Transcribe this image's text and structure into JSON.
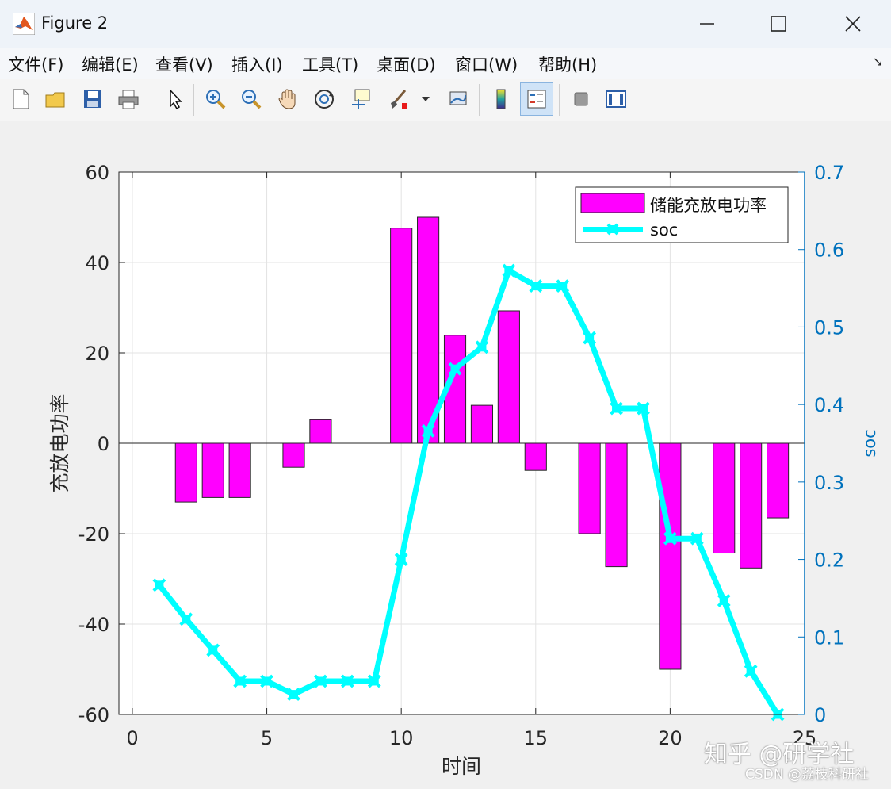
{
  "window": {
    "title": "Figure 2"
  },
  "menu": [
    {
      "label": "文件(F)"
    },
    {
      "label": "编辑(E)"
    },
    {
      "label": "查看(V)"
    },
    {
      "label": "插入(I)"
    },
    {
      "label": "工具(T)"
    },
    {
      "label": "桌面(D)"
    },
    {
      "label": "窗口(W)"
    },
    {
      "label": "帮助(H)"
    }
  ],
  "toolbar": [
    {
      "name": "new-figure-icon"
    },
    {
      "name": "open-file-icon"
    },
    {
      "name": "save-icon"
    },
    {
      "name": "print-icon"
    },
    {
      "name": "pointer-icon"
    },
    {
      "name": "zoom-in-icon"
    },
    {
      "name": "zoom-out-icon"
    },
    {
      "name": "pan-hand-icon"
    },
    {
      "name": "rotate-3d-icon"
    },
    {
      "name": "data-cursor-icon"
    },
    {
      "name": "brush-icon"
    },
    {
      "name": "link-plot-icon"
    },
    {
      "name": "colorbar-icon"
    },
    {
      "name": "legend-icon"
    },
    {
      "name": "hide-plot-tools-icon"
    },
    {
      "name": "show-plot-tools-icon"
    }
  ],
  "colors": {
    "bar": "#ff00ff",
    "line": "#00ffff",
    "right_axis": "#0072bd",
    "text": "#262626"
  },
  "chart_data": {
    "type": "bar+line",
    "xlabel": "时间",
    "ylabel_left": "充放电功率",
    "ylabel_right": "soc",
    "xlim": [
      -0.5,
      25
    ],
    "ylim_left": [
      -60,
      60
    ],
    "ylim_right": [
      0,
      0.7
    ],
    "xticks": [
      0,
      5,
      10,
      15,
      20,
      25
    ],
    "yticks_left": [
      -60,
      -40,
      -20,
      0,
      20,
      40,
      60
    ],
    "yticks_right": [
      0,
      0.1,
      0.2,
      0.3,
      0.4,
      0.5,
      0.6,
      0.7
    ],
    "yticklabels_right": [
      "0",
      "0.1",
      "0.2",
      "0.3",
      "0.4",
      "0.5",
      "0.6",
      "0.7"
    ],
    "grid": true,
    "legend_position": "top-right",
    "series": [
      {
        "name": "储能充放电功率",
        "type": "bar",
        "axis": "left",
        "x": [
          1,
          2,
          3,
          4,
          5,
          6,
          7,
          8,
          9,
          10,
          11,
          12,
          13,
          14,
          15,
          16,
          17,
          18,
          19,
          20,
          21,
          22,
          23,
          24
        ],
        "values": [
          0,
          -13,
          -12,
          -12,
          0,
          -5.3,
          5.2,
          0,
          0,
          47.6,
          50,
          23.9,
          8.4,
          29.3,
          -6,
          0,
          -20,
          -27.3,
          0,
          -50,
          0,
          -24.3,
          -27.6,
          -16.5
        ]
      },
      {
        "name": "soc",
        "type": "line",
        "axis": "right",
        "x": [
          1,
          2,
          3,
          4,
          5,
          6,
          7,
          8,
          9,
          10,
          11,
          12,
          13,
          14,
          15,
          16,
          17,
          18,
          19,
          20,
          21,
          22,
          23,
          24
        ],
        "values": [
          0.167,
          0.123,
          0.083,
          0.043,
          0.043,
          0.026,
          0.043,
          0.043,
          0.043,
          0.2,
          0.366,
          0.446,
          0.474,
          0.573,
          0.553,
          0.553,
          0.486,
          0.395,
          0.395,
          0.227,
          0.227,
          0.147,
          0.056,
          0.0
        ]
      }
    ]
  },
  "watermark": {
    "line1": "知乎 @研学社",
    "line2": "CSDN @荔枝科研社"
  }
}
